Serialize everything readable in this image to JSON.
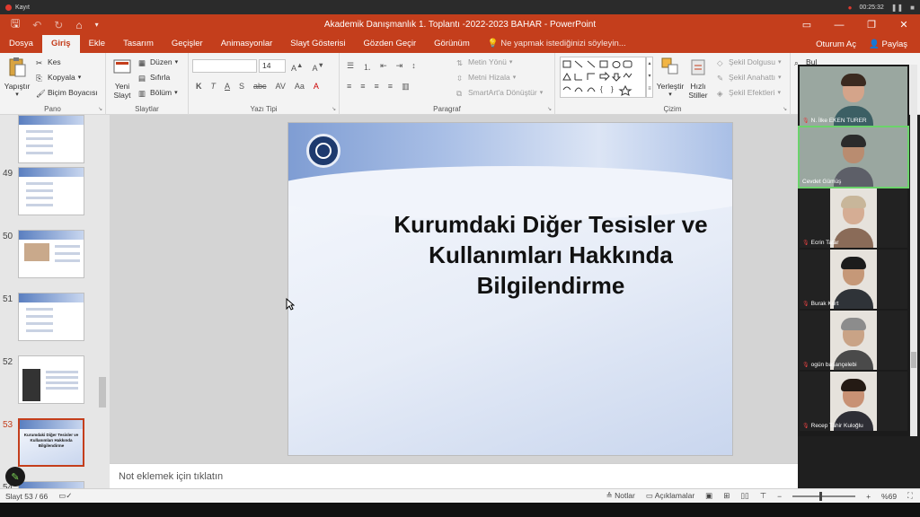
{
  "recorder": {
    "label": "Kayıt",
    "time": "00:25:32"
  },
  "window": {
    "title": "Akademik Danışmanlık 1. Toplantı -2022-2023 BAHAR - PowerPoint",
    "controls": [
      "restore",
      "minimize",
      "maximize",
      "close"
    ]
  },
  "tabs": [
    {
      "label": "Dosya"
    },
    {
      "label": "Giriş",
      "active": true
    },
    {
      "label": "Ekle"
    },
    {
      "label": "Tasarım"
    },
    {
      "label": "Geçişler"
    },
    {
      "label": "Animasyonlar"
    },
    {
      "label": "Slayt Gösterisi"
    },
    {
      "label": "Gözden Geçir"
    },
    {
      "label": "Görünüm"
    }
  ],
  "tell_me": "Ne yapmak istediğinizi söyleyin...",
  "sign_in": "Oturum Aç",
  "share": "Paylaş",
  "ribbon": {
    "clipboard": {
      "label": "Pano",
      "paste": "Yapıştır",
      "cut": "Kes",
      "copy": "Kopyala",
      "format_painter": "Biçim Boyacısı"
    },
    "slides": {
      "label": "Slaytlar",
      "new_slide_1": "Yeni",
      "new_slide_2": "Slayt",
      "layout": "Düzen",
      "reset": "Sıfırla",
      "section": "Bölüm"
    },
    "font": {
      "label": "Yazı Tipi",
      "size": "14"
    },
    "paragraph": {
      "label": "Paragraf",
      "text_direction": "Metin Yönü",
      "align_text": "Metni Hizala",
      "smartart": "SmartArt'a Dönüştür"
    },
    "drawing": {
      "label": "Çizim",
      "arrange": "Yerleştir",
      "quick_styles_1": "Hızlı",
      "quick_styles_2": "Stiller",
      "shape_fill": "Şekil Dolgusu",
      "shape_outline": "Şekil Anahattı",
      "shape_effects": "Şekil Efektleri"
    },
    "editing": {
      "find": "Bul"
    }
  },
  "thumbnails": [
    {
      "num": "",
      "kind": "doc"
    },
    {
      "num": "49",
      "kind": "doc"
    },
    {
      "num": "50",
      "kind": "photo"
    },
    {
      "num": "51",
      "kind": "doc"
    },
    {
      "num": "52",
      "kind": "dark"
    },
    {
      "num": "53",
      "kind": "title",
      "active": true,
      "title": "Kurumdaki Diğer Tesisler ve Kullanımları Hakkında Bilgilendirme"
    },
    {
      "num": "54",
      "kind": "doc"
    }
  ],
  "slide": {
    "title": "Kurumdaki Diğer Tesisler ve Kullanımları Hakkında Bilgilendirme"
  },
  "notes_placeholder": "Not eklemek için tıklatın",
  "status": {
    "slide_info": "Slayt 53 / 66",
    "notes": "Notlar",
    "comments": "Açıklamalar",
    "zoom": "%69"
  },
  "participants": [
    {
      "name": "N. İlke EKEN TURER",
      "muted": true,
      "hair": "#3b2a20",
      "skin": "#d4a48a",
      "body": "#3c5f64"
    },
    {
      "name": "Cevdet Gümüş",
      "muted": false,
      "active": true,
      "hair": "#2b2b2b",
      "skin": "#b98c70",
      "body": "#5d5f68"
    },
    {
      "name": "Ecrin Tatar",
      "muted": true,
      "hair": "#c8b69a",
      "skin": "#d5ad94",
      "body": "#8a6b58"
    },
    {
      "name": "Burak Kurt",
      "muted": true,
      "hair": "#1c1c1c",
      "skin": "#c59878",
      "body": "#2f3338"
    },
    {
      "name": "ogün başançelebi",
      "muted": true,
      "hair": "#8c8c8c",
      "skin": "#c9a386",
      "body": "#4a4a4a"
    },
    {
      "name": "Recep Tahir Kuloğlu",
      "muted": true,
      "hair": "#241a14",
      "skin": "#c89174",
      "body": "#2e2e35"
    }
  ]
}
